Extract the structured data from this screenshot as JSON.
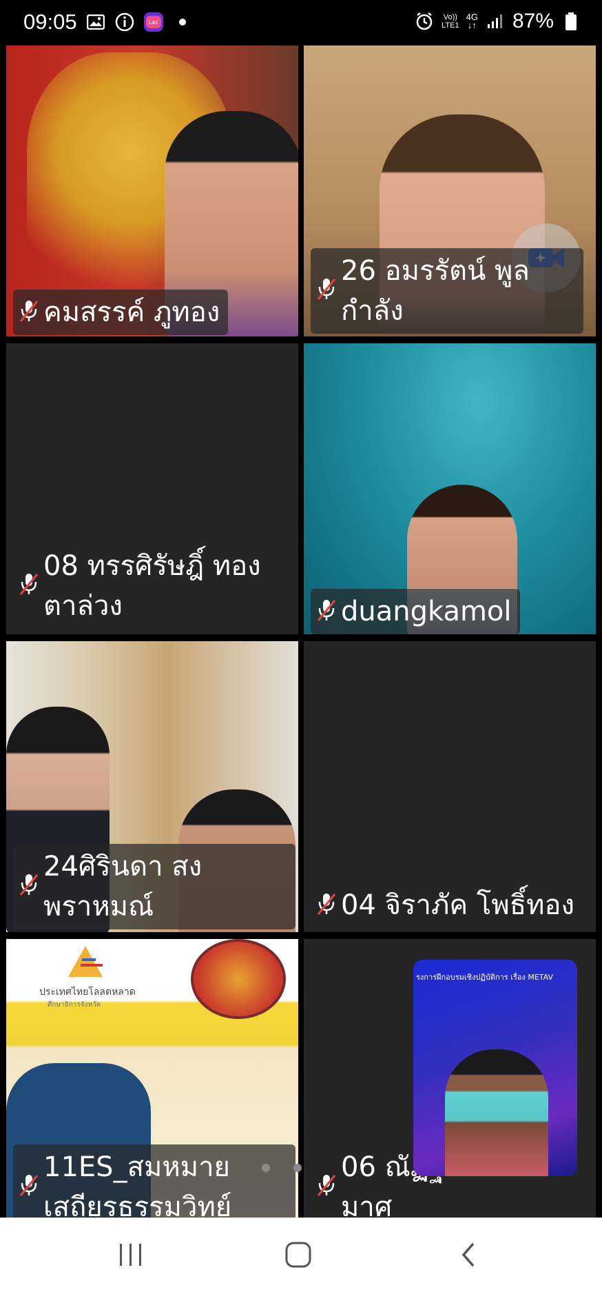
{
  "status": {
    "time": "09:05",
    "icons": [
      "gallery-icon",
      "info-icon",
      "lazada-icon",
      "notification-dot-icon"
    ],
    "badge": "Laz",
    "network_vo": "Vo))",
    "network_lte": "LTE1",
    "network_gen": "4G",
    "battery": "87%"
  },
  "participants": [
    {
      "name": "คมสรรค์ ภูทอง",
      "muted": true
    },
    {
      "name": "26 อมรรัตน์ พูล\nกำลัง",
      "muted": true
    },
    {
      "name": "08 ทรรศิรัษฎิ์ ทอง\nตาล่วง",
      "muted": true
    },
    {
      "name": "duangkamol",
      "muted": true
    },
    {
      "name": "24ศิรินดา สง\nพราหมณ์",
      "muted": true
    },
    {
      "name": "04 จิราภัค โพธิ์ทอง",
      "muted": true
    },
    {
      "name": "11ES_สมหมาย\nเสถียรธรรมวิทย์",
      "muted": true
    },
    {
      "name": "06 ณัฏฐ\nมาศ",
      "muted": true
    }
  ],
  "shared_content": {
    "banner_text": "รงการฝึกอบรมเชิงปฏิบัติการ เรื่อง METAV",
    "slide_caption": "ประเทศไทยโลลดหลาด",
    "slide_caption2": "ศึกษาธิการจังหวัด"
  },
  "colors": {
    "tile_bg": "#252525",
    "mic_muted": "#e0443e",
    "accent": "#2f6bff"
  },
  "nav": {
    "buttons": [
      "recent-apps",
      "home",
      "back"
    ]
  }
}
